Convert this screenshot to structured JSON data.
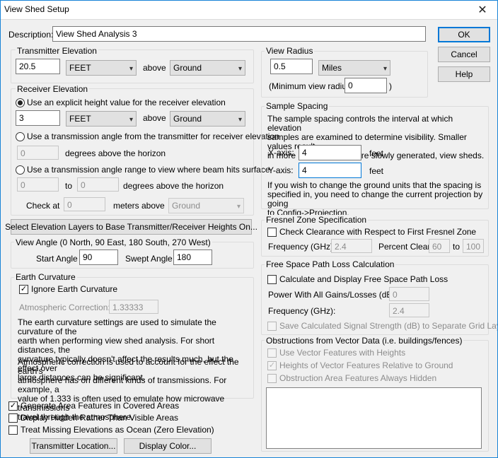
{
  "window": {
    "title": "View Shed Setup",
    "close": "✕"
  },
  "description": {
    "label": "Description:",
    "value": "View Shed Analysis 3"
  },
  "buttons": {
    "ok": "OK",
    "cancel": "Cancel",
    "help": "Help"
  },
  "transmitter": {
    "title": "Transmitter Elevation",
    "value": "20.5",
    "unit": "FEET",
    "above": "above",
    "ref": "Ground"
  },
  "receiver": {
    "title": "Receiver Elevation",
    "opt1": "Use an explicit height value for the receiver elevation",
    "value": "3",
    "unit": "FEET",
    "above": "above",
    "ref": "Ground",
    "opt2": "Use a transmission angle from the transmitter for receiver elevation",
    "angle": "0",
    "angle_suffix": "degrees above the horizon",
    "opt3": "Use a transmission angle range to view where beam hits surface",
    "range_from": "0",
    "range_to_label": "to",
    "range_to": "0",
    "range_suffix": "degrees above the horizon",
    "check_label": "Check at",
    "check_value": "0",
    "check_suffix": "meters above",
    "check_ref": "Ground"
  },
  "select_layers_button": "Select Elevation Layers to Base Transmitter/Receiver Heights On...",
  "view_angle": {
    "title": "View Angle (0 North, 90 East, 180 South, 270 West)",
    "start_label": "Start Angle",
    "start": "90",
    "swept_label": "Swept Angle",
    "swept": "180"
  },
  "earth": {
    "title": "Earth Curvature",
    "ignore_label": "Ignore Earth Curvature",
    "atm_label": "Atmospheric Correction:",
    "atm_value": "1.33333",
    "para1_lines": [
      "The earth curvature settings are used to simulate the curvature of the",
      "earth when performing view shed analysis. For short distances, the",
      "curvature typically doesn't affect the results much, but the effect over",
      "large distances can be significant."
    ],
    "para2_lines": [
      "Atmospheric correction is used to account for the effect the earth's",
      "atmosphere has on different kinds of transmissions. For example, a",
      "value of 1.333 is often used to emulate how microwave transmissions",
      "travel through the atmosphere."
    ]
  },
  "options": {
    "generate_area": "Generate Area Features in Covered Areas",
    "display_hidden": "Display Hidden Rather Than Visible Areas",
    "treat_missing": "Treat Missing Elevations as Ocean (Zero Elevation)"
  },
  "bottom_buttons": {
    "transmitter_location": "Transmitter Location...",
    "display_color": "Display Color..."
  },
  "view_radius": {
    "title": "View Radius",
    "value": "0.5",
    "unit": "Miles",
    "min_label": "(Minimum view radius:",
    "min_value": "0",
    "min_close": ")"
  },
  "sample_spacing": {
    "title": "Sample Spacing",
    "para1_lines": [
      "The sample spacing controls the interval at which elevation",
      "samples are examined to determine visibility. Smaller values result",
      "in more accurate, but more slowly generated, view sheds."
    ],
    "x_label": "X-axis:",
    "x_value": "4",
    "x_unit": "feet",
    "y_label": "Y-axis:",
    "y_value": "4",
    "y_unit": "feet",
    "para2_lines": [
      "If you wish to change the ground units that the spacing is",
      "specified in, you need to change the current projection by going",
      "to Config->Projection."
    ]
  },
  "fresnel": {
    "title": "Fresnel Zone Specification",
    "check_label": "Check Clearance with Respect to First Fresnel Zone",
    "freq_label": "Frequency (GHz):",
    "freq_value": "2.4",
    "pct_label": "Percent Clear:",
    "pct_from": "60",
    "pct_to_label": "to",
    "pct_to": "100"
  },
  "free_space": {
    "title": "Free Space Path Loss Calculation",
    "calc_label": "Calculate and Display Free Space Path Loss",
    "power_label": "Power With All Gains/Losses (dB):",
    "power_value": "0",
    "freq_label": "Frequency (GHz):",
    "freq_value": "2.4",
    "save_label": "Save Calculated Signal Strength (dB) to Separate Grid Layer"
  },
  "obstructions": {
    "title": "Obstructions from Vector Data (i.e. buildings/fences)",
    "use_vector": "Use Vector Features with Heights",
    "relative": "Heights of Vector Features Relative to Ground",
    "always_hidden": "Obstruction Area Features Always Hidden"
  },
  "glyphs": {
    "check": "✓",
    "arrow": "▾"
  }
}
